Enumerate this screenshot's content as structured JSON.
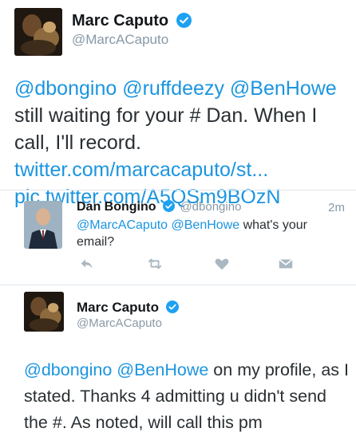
{
  "tweet1": {
    "name": "Marc Caputo",
    "handle": "@MarcACaputo",
    "text": {
      "mentions": "@dbongino @ruffdeezy @BenHowe",
      "part1": " still waiting for your # Dan. When I call, I'll record. ",
      "link1": "twitter.com/marcacaputo/st...",
      "link2": "pic.twitter.com/A5QSm9BOzN"
    }
  },
  "quoted": {
    "name": "Dan Bongino",
    "handle": "@dbongino",
    "time": "2m",
    "mentions": "@MarcACaputo @BenHowe",
    "text": " what's your email?"
  },
  "tweet2": {
    "name": "Marc Caputo",
    "handle": "@MarcACaputo",
    "mentions": "@dbongino @BenHowe",
    "text": " on my profile, as I stated. Thanks 4 admitting u didn't send the #. As noted, will call this pm"
  },
  "icons": {
    "verified": "verified-badge-icon",
    "reply": "reply-icon",
    "retweet": "retweet-icon",
    "like": "heart-icon",
    "dm": "direct-message-icon"
  },
  "colors": {
    "link": "#1b95e0",
    "verified": "#1da1f2",
    "muted": "#8899a6",
    "divider": "#e1e8ed"
  }
}
